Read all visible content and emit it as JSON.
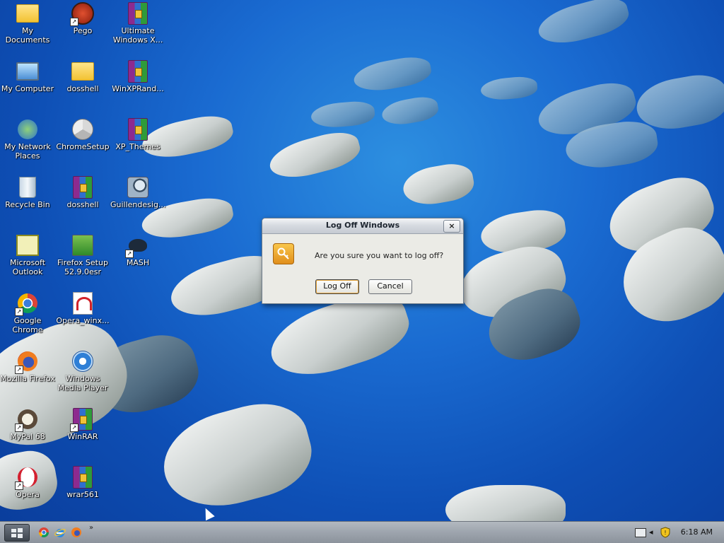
{
  "desktop": {
    "icons": [
      {
        "label": "My Documents",
        "icon": "my-documents-icon"
      },
      {
        "label": "Pego",
        "icon": "pego-icon"
      },
      {
        "label": "Ultimate Windows X...",
        "icon": "winrar-archive-icon"
      },
      {
        "label": "My Computer",
        "icon": "my-computer-icon"
      },
      {
        "label": "dosshell",
        "icon": "folder-icon"
      },
      {
        "label": "WinXPRand...",
        "icon": "winrar-archive-icon"
      },
      {
        "label": "My Network Places",
        "icon": "network-places-icon"
      },
      {
        "label": "ChromeSetup",
        "icon": "chrome-setup-icon"
      },
      {
        "label": "XP_Themes",
        "icon": "winrar-archive-icon"
      },
      {
        "label": "Recycle Bin",
        "icon": "recycle-bin-icon"
      },
      {
        "label": "dosshell",
        "icon": "winrar-archive-icon"
      },
      {
        "label": "Guillendesig...",
        "icon": "magnifier-icon"
      },
      {
        "label": "Microsoft Outlook",
        "icon": "outlook-icon"
      },
      {
        "label": "Firefox Setup 52.9.0esr",
        "icon": "firefox-setup-icon"
      },
      {
        "label": "MASH",
        "icon": "mash-icon"
      },
      {
        "label": "Google Chrome",
        "icon": "chrome-icon"
      },
      {
        "label": "Opera_winx...",
        "icon": "opera-installer-icon"
      },
      {
        "label": "Mozilla Firefox",
        "icon": "firefox-icon"
      },
      {
        "label": "Windows Media Player",
        "icon": "media-player-icon"
      },
      {
        "label": "MyPal 68",
        "icon": "mypal-icon"
      },
      {
        "label": "WinRAR",
        "icon": "winrar-archive-icon"
      },
      {
        "label": "Opera",
        "icon": "opera-icon"
      },
      {
        "label": "wrar561",
        "icon": "winrar-archive-icon"
      }
    ]
  },
  "dialog": {
    "title": "Log Off Windows",
    "close_label": "×",
    "message": "Are you sure you want to log off?",
    "logoff_label": "Log Off",
    "cancel_label": "Cancel",
    "icon": "key-icon"
  },
  "taskbar": {
    "quicklaunch_more": "»",
    "clock": "6:18 AM",
    "tray_icons": [
      "keyboard-icon",
      "arrow-left-icon",
      "security-shield-icon"
    ]
  },
  "colors": {
    "accent_orange": "#e9a73b",
    "desktop_blue": "#1a6bd1"
  }
}
